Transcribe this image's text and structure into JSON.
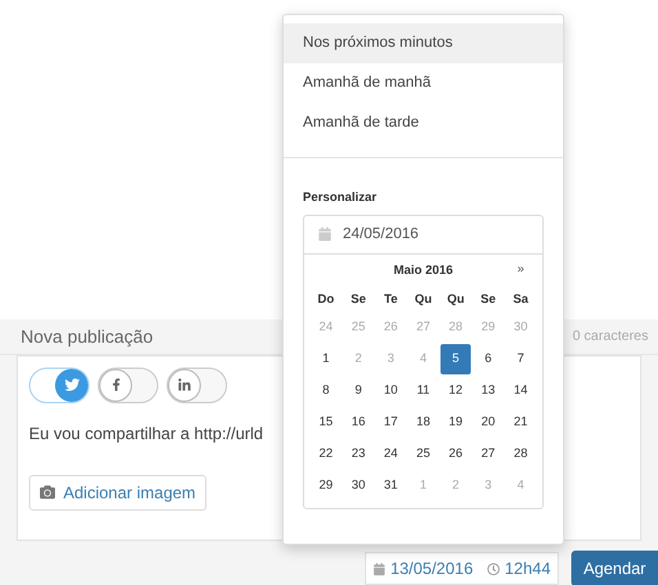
{
  "post": {
    "title": "Nova publicação",
    "char_count": "0 caracteres",
    "networks": [
      {
        "kind": "twitter",
        "on": true
      },
      {
        "kind": "facebook",
        "on": false
      },
      {
        "kind": "linkedin",
        "on": false
      }
    ],
    "text": "Eu vou compartilhar a http://urld",
    "add_image": "Adicionar imagem"
  },
  "schedule": {
    "date": "13/05/2016",
    "time": "12h44",
    "button": "Agendar"
  },
  "menu": {
    "options": [
      {
        "label": "Nos próximos minutos",
        "selected": true
      },
      {
        "label": "Amanhã de manhã",
        "selected": false
      },
      {
        "label": "Amanhã de tarde",
        "selected": false
      }
    ],
    "custom_label": "Personalizar",
    "date_value": "24/05/2016",
    "calendar": {
      "month": "Maio 2016",
      "next": "»",
      "weekdays": [
        "Do",
        "Se",
        "Te",
        "Qu",
        "Qu",
        "Se",
        "Sa"
      ],
      "weeks": [
        [
          {
            "day": "24",
            "muted": true,
            "selected": false
          },
          {
            "day": "25",
            "muted": true,
            "selected": false
          },
          {
            "day": "26",
            "muted": true,
            "selected": false
          },
          {
            "day": "27",
            "muted": true,
            "selected": false
          },
          {
            "day": "28",
            "muted": true,
            "selected": false
          },
          {
            "day": "29",
            "muted": true,
            "selected": false
          },
          {
            "day": "30",
            "muted": true,
            "selected": false
          }
        ],
        [
          {
            "day": "1",
            "muted": false,
            "selected": false
          },
          {
            "day": "2",
            "muted": true,
            "selected": false
          },
          {
            "day": "3",
            "muted": true,
            "selected": false
          },
          {
            "day": "4",
            "muted": true,
            "selected": false
          },
          {
            "day": "5",
            "muted": false,
            "selected": true
          },
          {
            "day": "6",
            "muted": false,
            "selected": false
          },
          {
            "day": "7",
            "muted": false,
            "selected": false
          }
        ],
        [
          {
            "day": "8",
            "muted": false,
            "selected": false
          },
          {
            "day": "9",
            "muted": false,
            "selected": false
          },
          {
            "day": "10",
            "muted": false,
            "selected": false
          },
          {
            "day": "11",
            "muted": false,
            "selected": false
          },
          {
            "day": "12",
            "muted": false,
            "selected": false
          },
          {
            "day": "13",
            "muted": false,
            "selected": false
          },
          {
            "day": "14",
            "muted": false,
            "selected": false
          }
        ],
        [
          {
            "day": "15",
            "muted": false,
            "selected": false
          },
          {
            "day": "16",
            "muted": false,
            "selected": false
          },
          {
            "day": "17",
            "muted": false,
            "selected": false
          },
          {
            "day": "18",
            "muted": false,
            "selected": false
          },
          {
            "day": "19",
            "muted": false,
            "selected": false
          },
          {
            "day": "20",
            "muted": false,
            "selected": false
          },
          {
            "day": "21",
            "muted": false,
            "selected": false
          }
        ],
        [
          {
            "day": "22",
            "muted": false,
            "selected": false
          },
          {
            "day": "23",
            "muted": false,
            "selected": false
          },
          {
            "day": "24",
            "muted": false,
            "selected": false
          },
          {
            "day": "25",
            "muted": false,
            "selected": false
          },
          {
            "day": "26",
            "muted": false,
            "selected": false
          },
          {
            "day": "27",
            "muted": false,
            "selected": false
          },
          {
            "day": "28",
            "muted": false,
            "selected": false
          }
        ],
        [
          {
            "day": "29",
            "muted": false,
            "selected": false
          },
          {
            "day": "30",
            "muted": false,
            "selected": false
          },
          {
            "day": "31",
            "muted": false,
            "selected": false
          },
          {
            "day": "1",
            "muted": true,
            "selected": false
          },
          {
            "day": "2",
            "muted": true,
            "selected": false
          },
          {
            "day": "3",
            "muted": true,
            "selected": false
          },
          {
            "day": "4",
            "muted": true,
            "selected": false
          }
        ]
      ]
    }
  }
}
